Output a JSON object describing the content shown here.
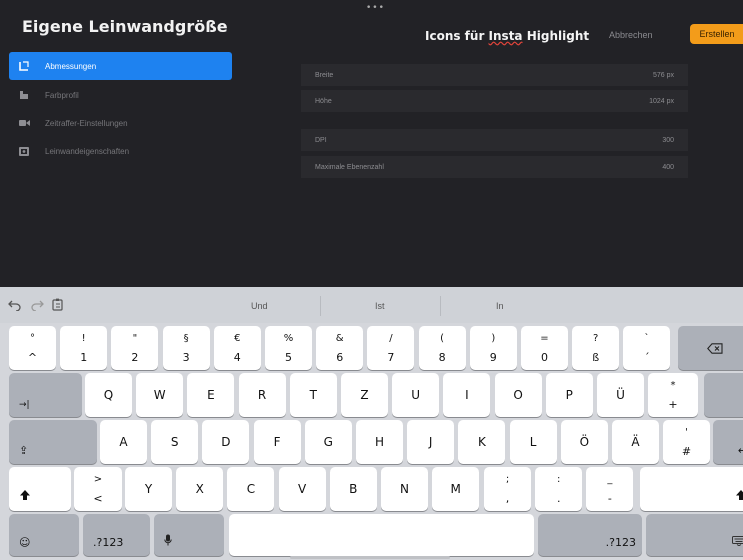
{
  "dialog": {
    "heading": "Eigene Leinwandgröße",
    "canvas_name_prefix": "Icons für ",
    "canvas_name_misspelled": "Insta",
    "canvas_name_suffix": " Highlight",
    "cancel_label": "Abbrechen",
    "create_label": "Erstellen",
    "accent_color": "#1e82f0",
    "create_color": "#f39c1a"
  },
  "nav": [
    {
      "label": "Abmessungen",
      "icon": "dimensions-icon",
      "active": true
    },
    {
      "label": "Farbprofil",
      "icon": "color-profile-icon",
      "active": false
    },
    {
      "label": "Zeitraffer-Einstellungen",
      "icon": "video-camera-icon",
      "active": false
    },
    {
      "label": "Leinwandeigenschaften",
      "icon": "canvas-properties-icon",
      "active": false
    }
  ],
  "fields": [
    {
      "label": "Breite",
      "value": "576 px"
    },
    {
      "label": "Höhe",
      "value": "1024 px"
    },
    {
      "label": "DPI",
      "value": "300"
    },
    {
      "label": "Maximale Ebenenzahl",
      "value": "400"
    }
  ],
  "suggestions": [
    "Und",
    "Ist",
    "In"
  ],
  "keyboard": {
    "number_row": [
      {
        "top": "°",
        "bottom": "^"
      },
      {
        "top": "!",
        "bottom": "1"
      },
      {
        "top": "\"",
        "bottom": "2"
      },
      {
        "top": "§",
        "bottom": "3"
      },
      {
        "top": "€",
        "bottom": "4"
      },
      {
        "top": "%",
        "bottom": "5"
      },
      {
        "top": "&",
        "bottom": "6"
      },
      {
        "top": "/",
        "bottom": "7"
      },
      {
        "top": "(",
        "bottom": "8"
      },
      {
        "top": ")",
        "bottom": "9"
      },
      {
        "top": "=",
        "bottom": "0"
      },
      {
        "top": "?",
        "bottom": "ß"
      },
      {
        "top": "`",
        "bottom": "´"
      }
    ],
    "row1": [
      "Q",
      "W",
      "E",
      "R",
      "T",
      "Z",
      "U",
      "I",
      "O",
      "P",
      "Ü"
    ],
    "row1_last": {
      "top": "*",
      "bottom": "+"
    },
    "row2": [
      "A",
      "S",
      "D",
      "F",
      "G",
      "H",
      "J",
      "K",
      "L",
      "Ö",
      "Ä"
    ],
    "row2_last": {
      "top": "'",
      "bottom": "#"
    },
    "row3_first": {
      "top": ">",
      "bottom": "<"
    },
    "row3": [
      "Y",
      "X",
      "C",
      "V",
      "B",
      "N",
      "M"
    ],
    "row3_punct": [
      {
        "top": ";",
        "bottom": ","
      },
      {
        "top": ":",
        "bottom": "."
      },
      {
        "top": "_",
        "bottom": "-"
      }
    ],
    "numbers_label": ".?123"
  }
}
